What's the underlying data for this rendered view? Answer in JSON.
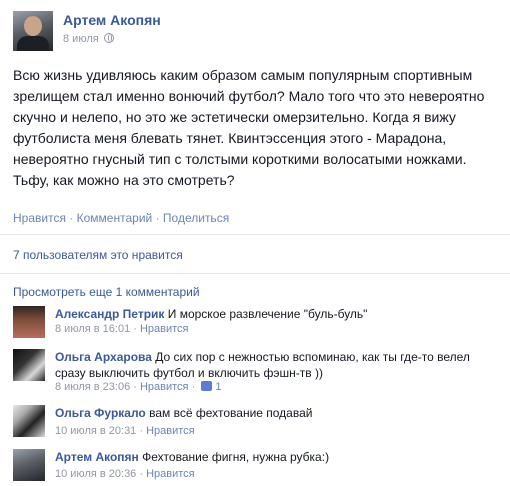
{
  "post": {
    "author": "Артем Акопян",
    "date": "8 июля",
    "privacy_icon": "globe-icon",
    "text_lines": [
      "Всю жизнь удивляюсь каким образом самым популярным спортивным",
      "зрелищем стал именно вонючий футбол? Мало того что это невероятно",
      "скучно и нелепо, но это же эстетически омерзительно. Когда я вижу",
      "футболиста меня блевать тянет. Квинтэссенция этого - Марадона,",
      "невероятно гнусный тип с толстыми короткими волосатыми ножками.",
      "Тьфу, как можно на это смотреть?"
    ],
    "actions": {
      "like": "Нравится",
      "comment": "Комментарий",
      "share": "Поделиться",
      "sep": "·"
    },
    "likes_text": "7 пользователям это нравится",
    "more_comments": "Просмотреть еще 1 комментарий"
  },
  "comments": [
    {
      "name": "Александр Петрик",
      "text": "И морское развлечение \"буль-буль\"",
      "date": "8 июля в 16:01",
      "like": "Нравится",
      "likes": ""
    },
    {
      "name": "Ольга Архарова",
      "text": "До сих пор с нежностью вспоминаю, как ты где-то велел",
      "text2": "сразу выключить футбол и включить фэшн-тв ))",
      "date": "8 июля в 23:06",
      "like": "Нравится",
      "likes": "1"
    },
    {
      "name": "Ольга Фуркало",
      "text": "вам всё фехтование подавай",
      "date": "10 июля в 20:31",
      "like": "Нравится",
      "likes": ""
    },
    {
      "name": "Артем Акопян",
      "text": "Фехтование фигня, нужна рубка:)",
      "date": "10 июля в 20:36",
      "like": "Нравится",
      "likes": ""
    }
  ],
  "colors": {
    "link": "#3b5998",
    "meta": "#9197a3",
    "text": "#141823"
  }
}
